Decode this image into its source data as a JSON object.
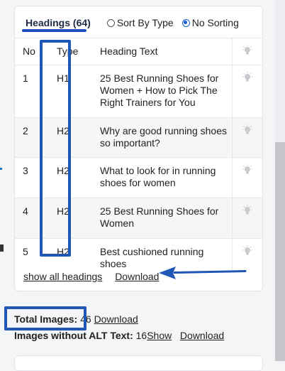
{
  "headings_panel": {
    "tab_label": "Headings (64)",
    "sort_options": [
      {
        "label": "Sort By Type",
        "checked": false
      },
      {
        "label": "No Sorting",
        "checked": true
      }
    ],
    "columns": {
      "no": "No",
      "type": "Type",
      "text": "Heading Text",
      "icon": "lightbulb-icon"
    },
    "rows": [
      {
        "no": "1",
        "type": "H1",
        "text": "25 Best Running Shoes for Women + How to Pick The Right Trainers for You"
      },
      {
        "no": "2",
        "type": "H2",
        "text": "Why are good running shoes so important?"
      },
      {
        "no": "3",
        "type": "H2",
        "text": "What to look for in running shoes for women"
      },
      {
        "no": "4",
        "type": "H2",
        "text": "25 Best Running Shoes for Women"
      },
      {
        "no": "5",
        "type": "H2",
        "text": "Best cushioned running shoes"
      }
    ],
    "show_all_label": "show all headings",
    "download_label": "Download"
  },
  "images": {
    "total_label": "Total Images:",
    "total_value": "46",
    "total_download": "Download",
    "no_alt_label": "Images without ALT Text:",
    "no_alt_value": "16",
    "show_label": "Show",
    "no_alt_download": "Download"
  },
  "colors": {
    "highlight_box": "#1f56b8",
    "arrow": "#1f56b8",
    "radio_checked": "#1a5fd0"
  }
}
